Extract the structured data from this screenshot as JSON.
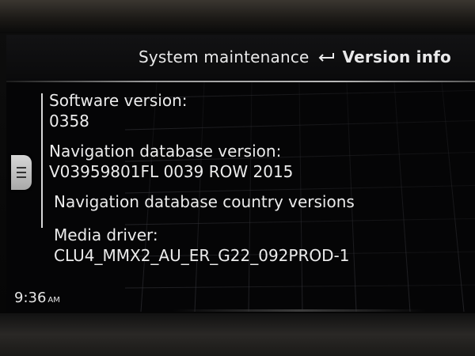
{
  "header": {
    "parent_label": "System maintenance",
    "current_label": "Version info",
    "back_icon": "return-arrow-icon"
  },
  "entries": [
    {
      "label": "Software version:",
      "value": "0358"
    },
    {
      "label": "Navigation database version:",
      "value": "V03959801FL 0039 ROW 2015"
    },
    {
      "label": "Navigation database country versions",
      "value": ""
    },
    {
      "label": "Media driver:",
      "value": "CLU4_MMX2_AU_ER_G22_092PROD-1"
    }
  ],
  "side_menu": {
    "icon": "menu-lines-icon"
  },
  "status": {
    "time": "9:36",
    "ampm": "AM"
  },
  "colors": {
    "text": "#ececec",
    "background": "#050506",
    "divider": "#b9b9b9"
  }
}
